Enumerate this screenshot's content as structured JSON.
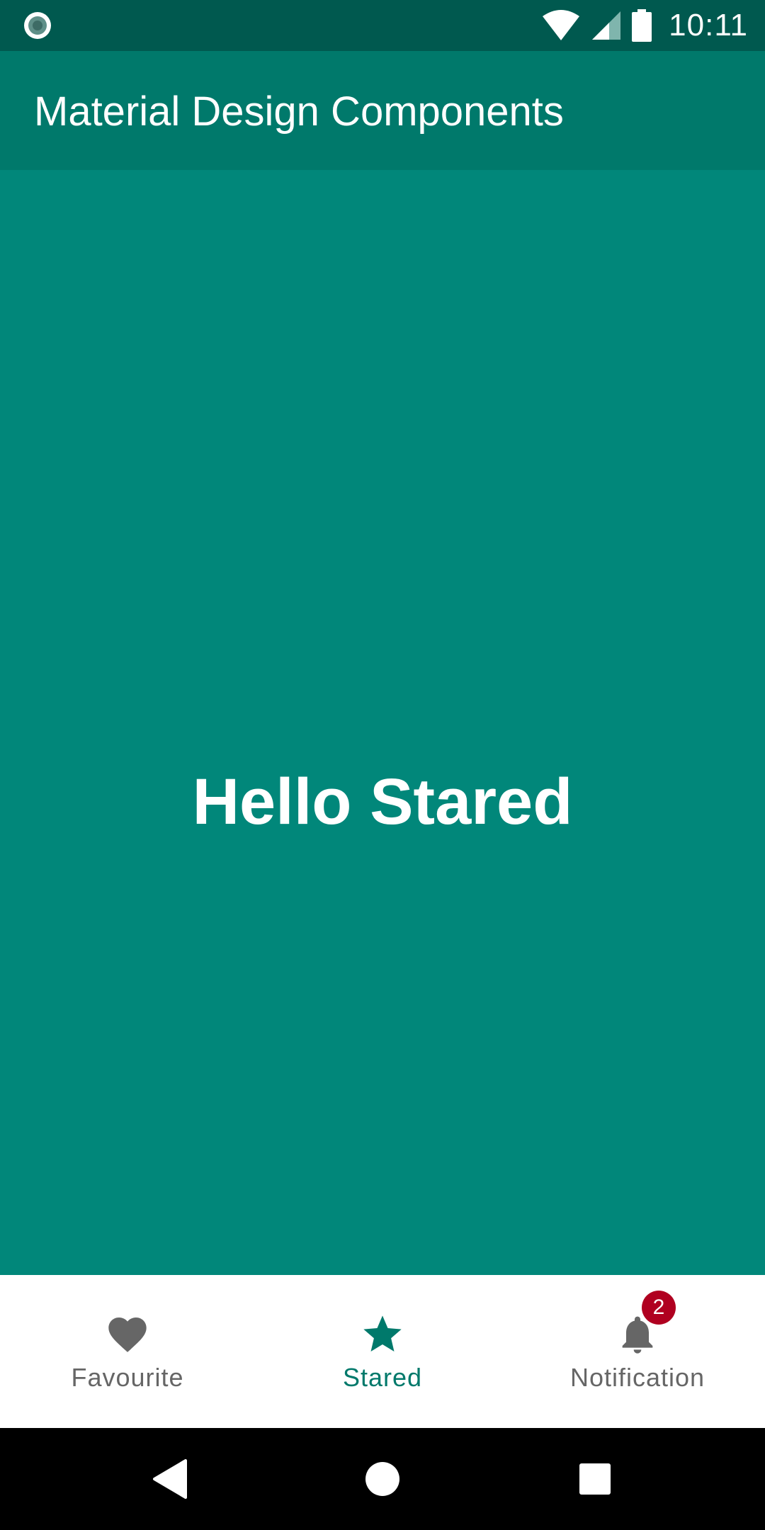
{
  "status_bar": {
    "time": "10:11",
    "left_icon": "record-icon",
    "icons": [
      "wifi-icon",
      "signal-icon",
      "battery-icon"
    ]
  },
  "app_bar": {
    "title": "Material Design Components"
  },
  "content": {
    "message": "Hello Stared"
  },
  "bottom_nav": {
    "items": [
      {
        "label": "Favourite",
        "icon": "heart-icon",
        "active": false
      },
      {
        "label": "Stared",
        "icon": "star-icon",
        "active": true
      },
      {
        "label": "Notification",
        "icon": "bell-icon",
        "active": false,
        "badge": "2"
      }
    ]
  },
  "system_nav": {
    "buttons": [
      "back-icon",
      "home-icon",
      "recents-icon"
    ]
  },
  "colors": {
    "primary": "#00796B",
    "primary_dark": "#00594F",
    "content_bg": "#01877A",
    "badge": "#B00020",
    "inactive": "#666666"
  }
}
